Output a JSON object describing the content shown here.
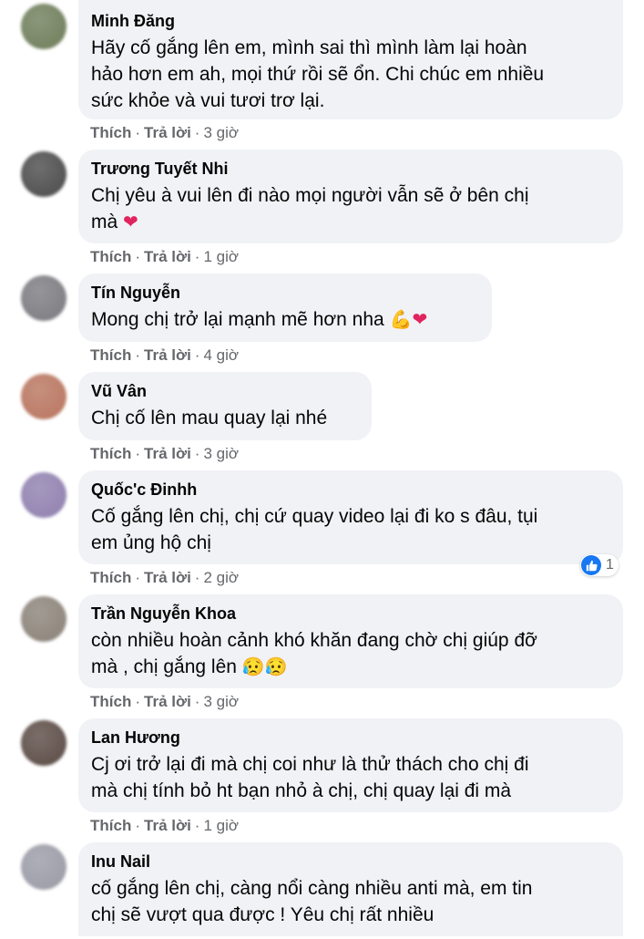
{
  "actions": {
    "like": "Thích",
    "reply": "Trả lời",
    "sep": "·"
  },
  "comments": [
    {
      "author": "Minh Đăng",
      "lines": [
        "Hãy cố gắng lên em, mình sai thì mình làm lại hoàn",
        "hảo hơn em ah, mọi thứ rồi sẽ ổn. Chi chúc em nhiều",
        "sức khỏe và vui tươi trơ lại."
      ],
      "time": "3 giờ",
      "avatar_color": "#6e7d5a"
    },
    {
      "author": "Trương Tuyết Nhi",
      "lines": [
        "Chị yêu à vui lên đi nào mọi người vẫn sẽ ở bên chị",
        "mà"
      ],
      "time": "1 giờ",
      "avatar_color": "#4a4a4a",
      "trailing": "heart"
    },
    {
      "author": "Tín Nguyễn",
      "lines": [
        "Mong chị trở lại mạnh mẽ hơn nha"
      ],
      "time": "4 giờ",
      "avatar_color": "#7a7a80",
      "trailing": "muscle-heart"
    },
    {
      "author": "Vũ Vân",
      "lines": [
        "Chị cố lên mau quay lại nhé"
      ],
      "time": "3 giờ",
      "avatar_color": "#b8745e"
    },
    {
      "author": "Quốc'c Đinhh",
      "lines": [
        "Cố gắng lên chị, chị cứ quay video lại đi ko s đâu, tụi",
        "em ủng hộ chị"
      ],
      "time": "2 giờ",
      "avatar_color": "#8f7fae",
      "reaction_count": "1"
    },
    {
      "author": "Trần Nguyễn Khoa",
      "lines": [
        "còn nhiều hoàn cảnh khó khăn đang chờ chị giúp đỡ",
        "mà , chị gắng lên"
      ],
      "time": "3 giờ",
      "avatar_color": "#8a8278",
      "trailing": "sad-sad"
    },
    {
      "author": "Lan Hương",
      "lines": [
        "Cj ơi trở lại đi mà chị coi như là thử thách cho chị đi",
        "mà chị tính bỏ ht bạn nhỏ à chị, chị quay lại đi mà"
      ],
      "time": "1 giờ",
      "avatar_color": "#5a4a44"
    },
    {
      "author": "Inu Nail",
      "lines": [
        "cố gắng lên chị, càng nổi càng nhiều anti mà, em tin",
        "chị sẽ vượt qua được ! Yêu chị rất nhiều"
      ],
      "time": "",
      "avatar_color": "#9a9aa6"
    }
  ]
}
